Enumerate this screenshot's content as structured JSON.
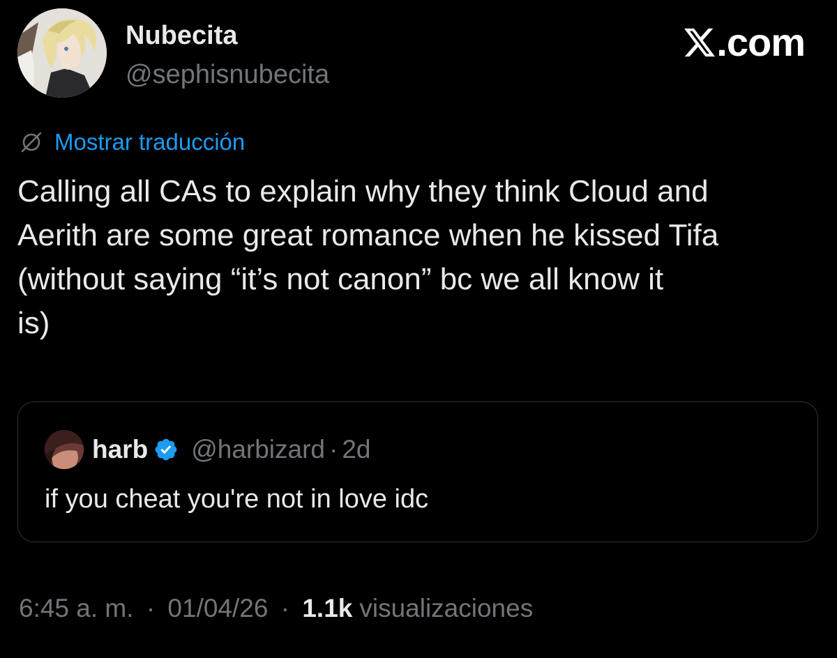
{
  "author": {
    "display_name": "Nubecita",
    "handle": "@sephisnubecita",
    "avatar_icon": "anime-character-avatar"
  },
  "brand": {
    "label": ".com",
    "icon": "x-logo-icon",
    "color": "#ffffff"
  },
  "translation": {
    "label": "Mostrar traducción",
    "icon": "globe-strikethrough-icon",
    "color": "#1d9bf0"
  },
  "tweet": {
    "text": "Calling all CAs to explain why they think Cloud and\nAerith are some great romance when he kissed Tifa\n(without saying “it’s not canon” bc we all know it\nis)"
  },
  "quoted_tweet": {
    "display_name": "harb",
    "verified": true,
    "verified_color": "#1d9bf0",
    "handle": "@harbizard",
    "separator": "·",
    "time": "2d",
    "text": "if you cheat you're not in love idc"
  },
  "meta": {
    "time": "6:45 a. m.",
    "date": "01/04/26",
    "separator": "·",
    "views_count": "1.1k",
    "views_label": "visualizaciones"
  },
  "colors": {
    "background": "#000000",
    "primary_text": "#e7e9ea",
    "secondary_text": "#71767b",
    "border": "#2f3336"
  }
}
